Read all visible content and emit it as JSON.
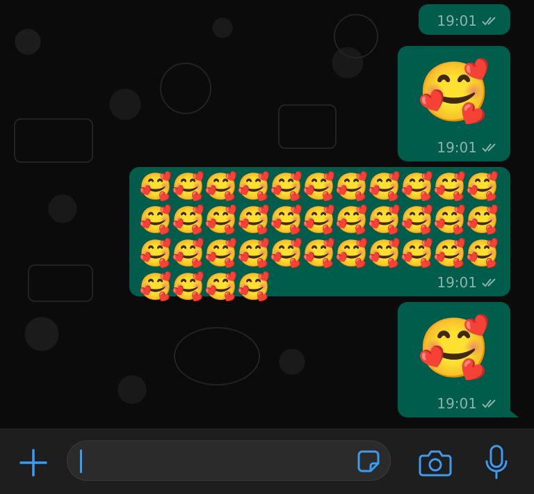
{
  "conversation": {
    "messages": [
      {
        "id": "m1",
        "kind": "time-only",
        "time": "19:01",
        "status_icon": "double-check-icon"
      },
      {
        "id": "m2",
        "kind": "big-emoji",
        "emoji": "🥰",
        "time": "19:01",
        "status_icon": "double-check-icon"
      },
      {
        "id": "m3",
        "kind": "emoji-grid",
        "emoji": "🥰",
        "emoji_count": 37,
        "time": "19:01",
        "status_icon": "double-check-icon"
      },
      {
        "id": "m4",
        "kind": "big-emoji",
        "emoji": "🥰",
        "time": "19:01",
        "status_icon": "double-check-icon"
      }
    ]
  },
  "composer": {
    "input_value": "",
    "icons": {
      "attach": "plus-icon",
      "sticker": "sticker-icon",
      "camera": "camera-icon",
      "mic": "microphone-icon"
    }
  },
  "colors": {
    "background": "#0b0b0b",
    "bubble_outgoing": "#005c4b",
    "meta_text": "#8fb3aa",
    "accent": "#3d9bf0",
    "composer_bar": "#1e1e1e"
  }
}
